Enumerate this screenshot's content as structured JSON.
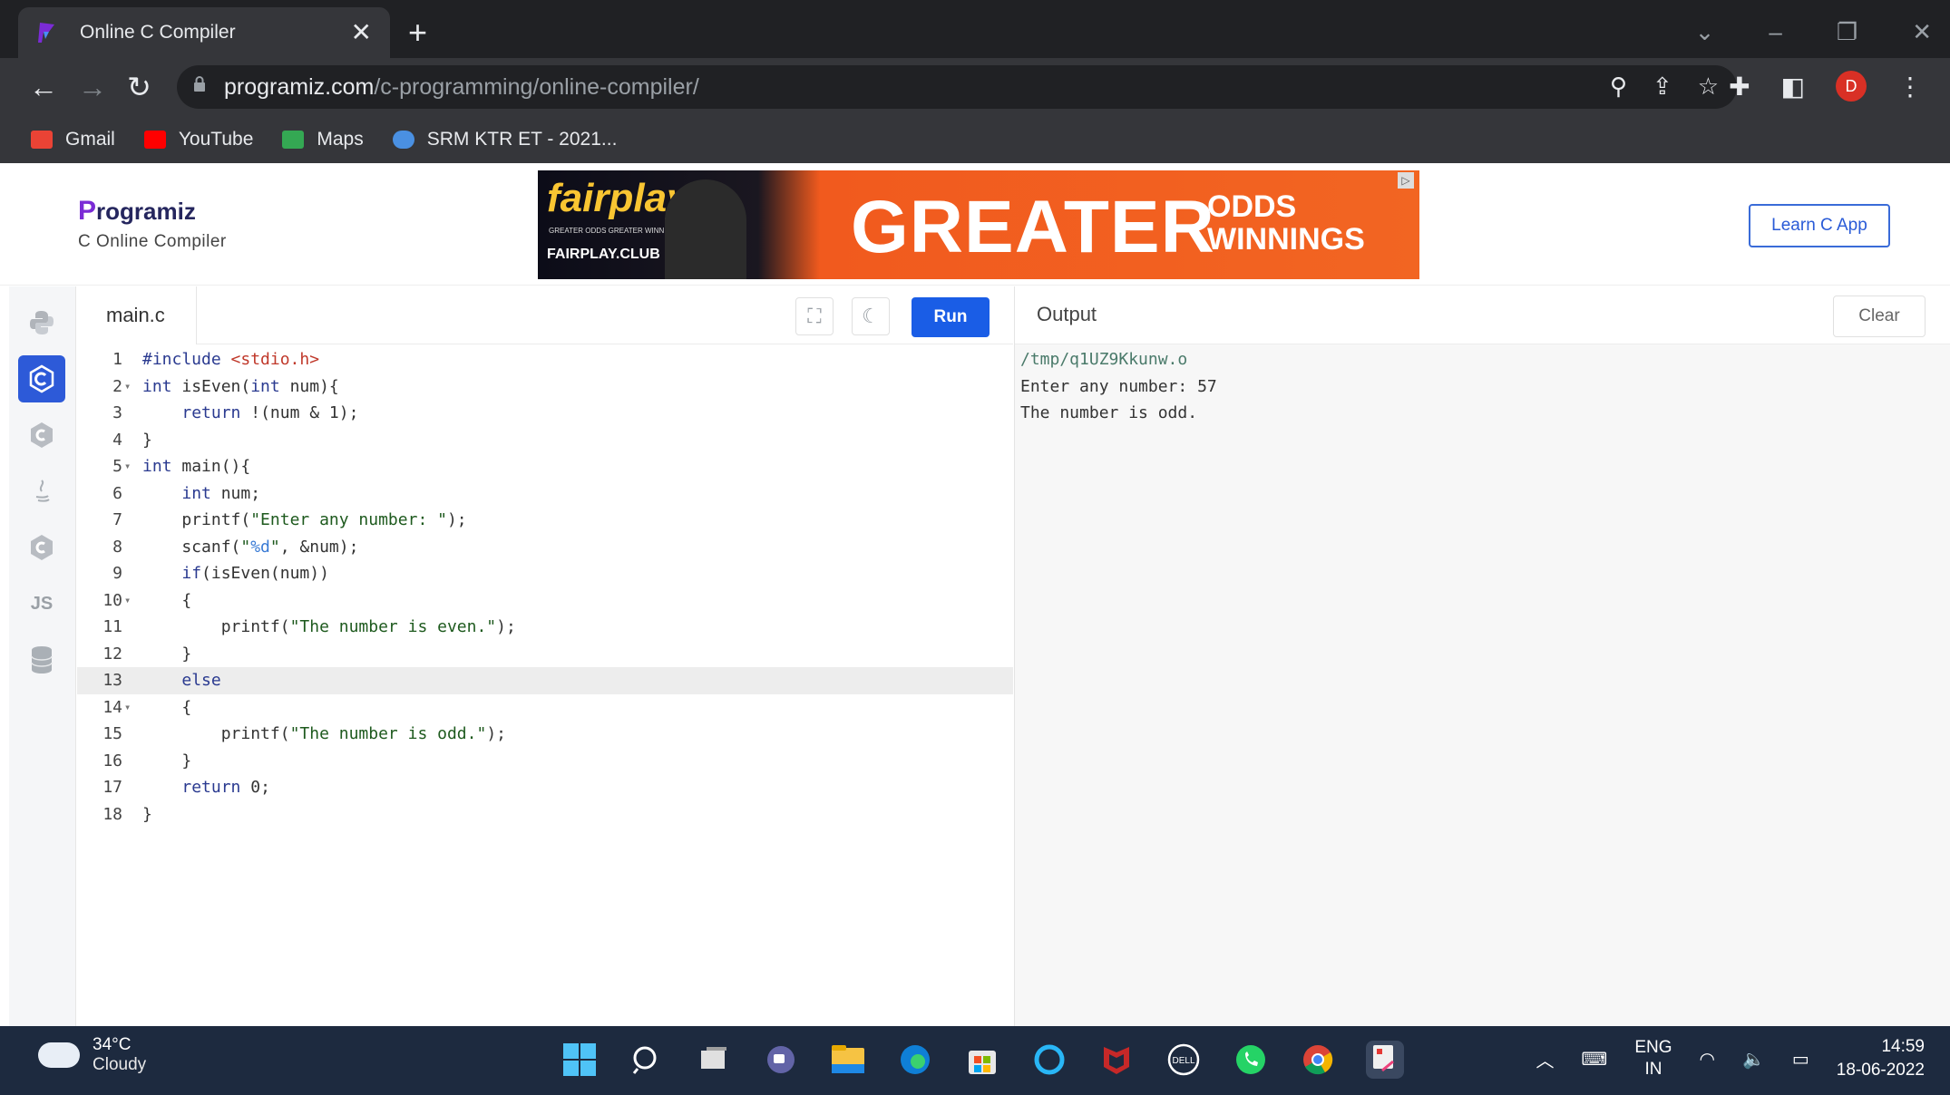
{
  "browser": {
    "tab_title": "Online C Compiler",
    "tab_close": "✕",
    "new_tab": "+",
    "url_host": "programiz.com",
    "url_path": "/c-programming/online-compiler/",
    "bookmarks": [
      {
        "label": "Gmail",
        "color": "#ea4335"
      },
      {
        "label": "YouTube",
        "color": "#ff0000"
      },
      {
        "label": "Maps",
        "color": "#34a853"
      },
      {
        "label": "SRM KTR ET - 2021...",
        "color": "#4a90e2"
      }
    ],
    "profile_initial": "D"
  },
  "header": {
    "logo_letter": "P",
    "logo_rest": "rogramiz",
    "subtitle": "C Online Compiler",
    "learn_button": "Learn C App",
    "ad": {
      "brand": "fairplay",
      "tagline_small": "GREATER ODDS GREATER WINNINGS",
      "club": "FAIRPLAY.CLUB",
      "headline": "GREATER",
      "odds_line1": "ODDS",
      "odds_line2": "WINNINGS"
    }
  },
  "rail": {
    "items": [
      "python",
      "c",
      "cpp",
      "java",
      "csharp",
      "JS",
      "sql"
    ],
    "active": "c"
  },
  "editor": {
    "file_name": "main.c",
    "run_label": "Run",
    "lines": [
      "#include <stdio.h>",
      "int isEven(int num){",
      "    return !(num & 1);",
      "}",
      "int main(){",
      "    int num;",
      "    printf(\"Enter any number: \");",
      "    scanf(\"%d\", &num);",
      "    if(isEven(num))",
      "    {",
      "        printf(\"The number is even.\");",
      "    }",
      "    else",
      "    {",
      "        printf(\"The number is odd.\");",
      "    }",
      "    return 0;",
      "}"
    ],
    "active_line": 13
  },
  "output": {
    "title": "Output",
    "clear_label": "Clear",
    "lines": [
      "/tmp/q1UZ9Kkunw.o",
      "Enter any number: 57",
      "The number is odd."
    ]
  },
  "taskbar": {
    "temperature": "34°C",
    "weather": "Cloudy",
    "lang1": "ENG",
    "lang2": "IN",
    "time": "14:59",
    "date": "18-06-2022"
  }
}
